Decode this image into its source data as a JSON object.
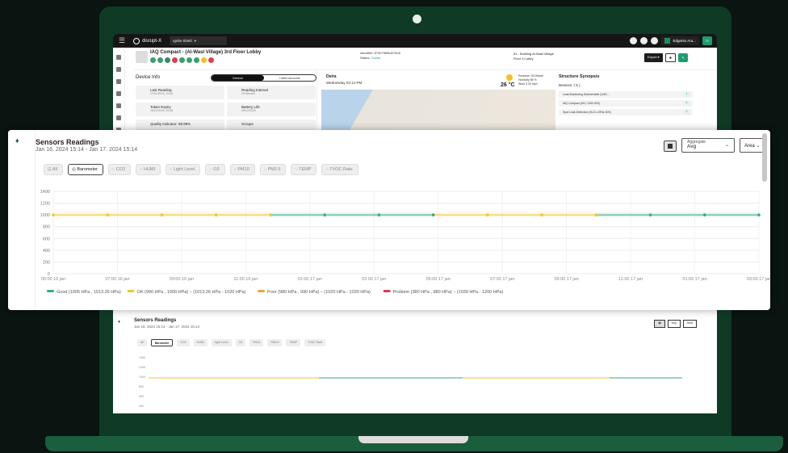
{
  "topbar": {
    "brand": "disrupt-X",
    "user": "Ignite Shekl",
    "account": "Edgento Ara..."
  },
  "device_header": {
    "title": "IAQ Compact - (Al-Wasl Village) 3rd Floor Lobby",
    "identifier_label": "Identifier:",
    "identifier_value": "6730796f5d27528",
    "status_label": "Status:",
    "status_value": "Online",
    "building": "51 - Building Al-Wasl Village",
    "floor": "Floor 3 Lobby",
    "export_label": "Export"
  },
  "device_info": {
    "title": "Device Info",
    "tabs": [
      "General",
      "Linked Accounts"
    ],
    "cards": [
      {
        "label": "Last Reading",
        "value": "17/01/2024, 15:09"
      },
      {
        "label": "Reading Interval",
        "value": "10 Minutes"
      },
      {
        "label": "Token Expiry",
        "value": "28/12/2026, 15:58"
      },
      {
        "label": "Battery Life",
        "value": "28/12/2025"
      },
      {
        "label": "Quality Indicator: 88.89%",
        "value": ""
      },
      {
        "label": "Groups",
        "value": ""
      }
    ]
  },
  "map": {
    "location": "Deira",
    "datetime": "Wednesday 03:14 PM",
    "temperature": "26 °C",
    "pressure": "Pressure 1013mbar",
    "humidity": "Humidity 58 %",
    "wind": "Wind 3.33 mph"
  },
  "synopsis": {
    "title": "Structure Synopsis",
    "devices_label": "Devices: ( 5 )",
    "rows": [
      {
        "name": "Leak Monitoring Submersible (LMS...",
        "count": "1"
      },
      {
        "name": "IAQ Compact (IAC 1300-S00)",
        "count": "2"
      },
      {
        "name": "Spot Leak Detection (SLD-LORA-S00)",
        "count": "2"
      }
    ]
  },
  "sensors": {
    "title": "Sensors Readings",
    "date_range": "Jan 16. 2024 15:14 - Jan 17. 2024 15:14",
    "aggregate_label": "Aggregate",
    "aggregate_value": "Avg",
    "chart_type_value": "Area",
    "tabs": [
      "All",
      "Barometer",
      "CO2",
      "HUMI",
      "Light Level",
      "O3",
      "PM10",
      "PM2.5",
      "TEMP",
      "TVOC Rate"
    ],
    "active_tab": "Barometer",
    "legend": [
      {
        "label": "Good (1005 HPa , 1013.26 HPa)",
        "color": "#3aa878"
      },
      {
        "label": "OK (990 HPa , 1000 HPa) – (1013.26 HPa - 1020 HPa)",
        "color": "#f2c62a"
      },
      {
        "label": "Poor (980 HPa , 990 HPa) – (1020 HPa - 1030 HPa)",
        "color": "#f2a33a"
      },
      {
        "label": "Problem (380 HPa , 980 HPa) – (1030 HPa - 1200 HPa)",
        "color": "#e0384a"
      }
    ]
  },
  "lower_preview": {
    "title": "Sensors Readings",
    "date_range": "Jan 16. 2024 15:14 - Jan 17. 2024 15:14",
    "aggregate_value": "Avg",
    "chart_type_value": "Area",
    "y_ticks": [
      "1400",
      "1200",
      "1000",
      "800",
      "600",
      "400"
    ]
  },
  "chart_data": {
    "type": "line",
    "title": "Sensors Readings",
    "x": [
      "05:00 16 jan",
      "07:00 16 jan",
      "09:00 16 jan",
      "11:00 16 jan",
      "01:00 17 jan",
      "03:00 17 jan",
      "05:00 17 jan",
      "07:00 17 jan",
      "09:00 17 jan",
      "11:00 17 jan",
      "01:00 17 jan",
      "03:00 17 jan"
    ],
    "yticks": [
      "0",
      "200",
      "400",
      "600",
      "800",
      "1000",
      "1200",
      "1400"
    ],
    "ylim": [
      0,
      1400
    ],
    "series": [
      {
        "values": [
          1000,
          1000,
          1000,
          1000,
          1000,
          1000,
          1000,
          1000,
          1000,
          1000,
          1000,
          1000,
          1000,
          1000
        ]
      }
    ],
    "point_colors": [
      "#f2c62a",
      "#f2c62a",
      "#f2c62a",
      "#f2c62a",
      "#f2c62a",
      "#3aa878",
      "#3aa878",
      "#3aa878",
      "#f2c62a",
      "#f2c62a",
      "#f2c62a",
      "#3aa878",
      "#3aa878",
      "#3aa878"
    ],
    "grid": true,
    "legend_position": "bottom"
  }
}
